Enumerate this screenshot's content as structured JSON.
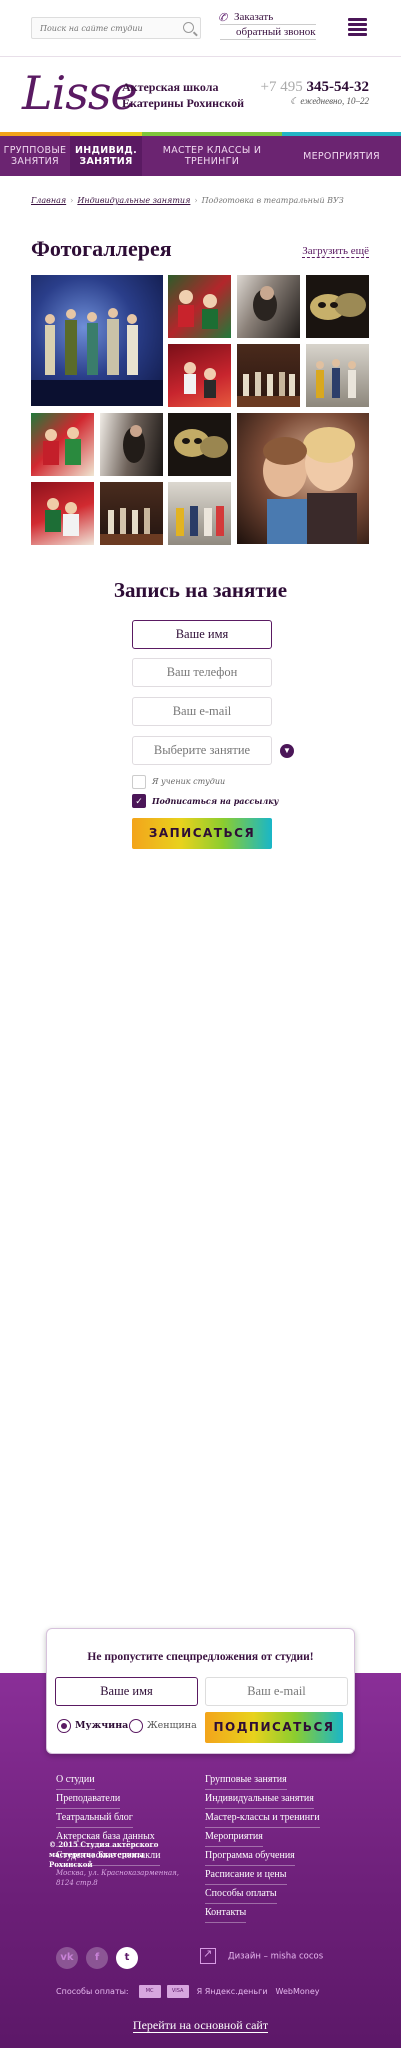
{
  "search": {
    "placeholder": "Поиск на сайте студии"
  },
  "callback": {
    "line1": "Заказать",
    "line2": "обратный звонок"
  },
  "logo": {
    "text": "Lisse"
  },
  "school": {
    "line1": "Актерская школа",
    "line2": "Екатерины Рохинской"
  },
  "phone": {
    "code": "+7 495",
    "number": "345-54-32",
    "hours": "ежедневно, 10–22"
  },
  "nav": [
    {
      "label": "ГРУППОВЫЕ ЗАНЯТИЯ",
      "accent": "#f2a31b"
    },
    {
      "label": "ИНДИВИД. ЗАНЯТИЯ",
      "accent": "#e7d21c"
    },
    {
      "label": "МАСТЕР КЛАССЫ И ТРЕНИНГИ",
      "accent": "#7fc63b"
    },
    {
      "label": "МЕРОПРИЯТИЯ",
      "accent": "#22b5c5"
    }
  ],
  "breadcrumbs": {
    "home": "Главная",
    "section": "Индивидуальные занятия",
    "current": "Подготовка в театральный ВУЗ"
  },
  "gallery": {
    "title": "Фотогаллерея",
    "more": "Загрузить ещё"
  },
  "form": {
    "title": "Запись на занятие",
    "name": "Ваше имя",
    "phone": "Ваш телефон",
    "email": "Ваш e-mail",
    "select": "Выберите занятие",
    "student": "Я ученик студии",
    "subscribe": "Подписаться на рассылку",
    "submit": "ЗАПИСАТЬСЯ"
  },
  "popup": {
    "title": "Не пропустите спецпредложения от студии!",
    "name": "Ваше имя",
    "email": "Ваш e-mail",
    "male": "Мужчина",
    "female": "Женщина",
    "submit": "ПОДПИСАТЬСЯ"
  },
  "footer": {
    "col1": [
      "О студии",
      "Преподаватели",
      "Театральный блог",
      "Актерская база данных",
      "Студенческие спектакли"
    ],
    "col2": [
      "Групповые занятия",
      "Индивидуальные занятия",
      "Мастер-классы и тренинги",
      "Мероприятия",
      "Программа обучения",
      "Расписание и цены",
      "Способы оплаты",
      "Контакты"
    ],
    "copyright": "© 2015 Студия актёрского мастерства Екатерины Рохинской",
    "address": "Москва, ул. Красноказарменная, 8124 стр.8",
    "design": "Дизайн – misha cocos",
    "payment_label": "Способы оплаты:",
    "pay1": "MC",
    "pay2": "VISA",
    "pay3": "Я Яндекс.деньги",
    "pay4": "WebMoney",
    "main_site": "Перейти на основной сайт"
  },
  "social": {
    "vk": "vk",
    "fb": "f",
    "tw": "t"
  }
}
